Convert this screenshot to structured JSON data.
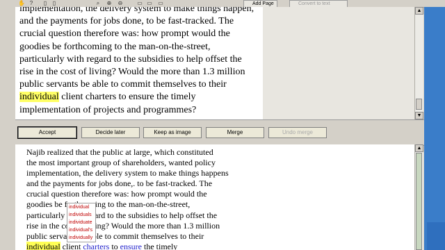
{
  "toolbar": {
    "add_page_label": "Add Page",
    "convert_label": "Convert to text",
    "icons": [
      "hand-icon",
      "question-icon",
      "page-icon",
      "magnifier-icon",
      "zoom-in-icon",
      "zoom-out-icon",
      "page-icon",
      "page-icon",
      "page-icon",
      "page-icon"
    ]
  },
  "scan": {
    "lines": [
      "implementation, the delivery system to make things happen,",
      "and the payments for jobs done, to be fast-tracked. The",
      "crucial question therefore was: how prompt would the",
      "goodies be forthcoming to the man-on-the-street,",
      "particularly with regard to the subsidies to help offset the",
      "rise in the cost of living? Would the more than 1.3 million",
      "public servants be able to commit themselves to their"
    ],
    "line8_highlight": "individual",
    "line8_rest": " client charters to ensure the timely",
    "line9": "implementation of projects and programmes?"
  },
  "buttons": {
    "accept": "Accept",
    "decide_later": "Decide later",
    "keep_as_image": "Keep as image",
    "merge": "Merge",
    "undo_merge": "Undo merge"
  },
  "editor": {
    "lines": [
      "Najib realized that the public at large, which constituted",
      "the most important group of shareholders, wanted policy",
      "implementation, the delivery system to make things happens",
      "and the payments for jobs done,. to be fast-tracked. The",
      "crucial question therefore was: how prompt would the",
      "goodies be forthcoming to the man-on-the-street,",
      "particularly with regard to the subsidies to help offset the",
      "rise in the cost of living? Would the more than 1.3 million",
      "public servants be able to commit themselves to their"
    ],
    "last_line": {
      "selected": "individual",
      "t1": " client ",
      "blue1": "charters",
      "t2": " to ",
      "blue2": "ensure",
      "t3": " the timely"
    }
  },
  "suggestions": [
    "individual",
    "individuals",
    "individuate",
    "individual's",
    "individually"
  ],
  "colors": {
    "highlight": "#ffff66",
    "misspelled_blue": "#2222cc",
    "desktop_blue": "#3a7dc9"
  }
}
